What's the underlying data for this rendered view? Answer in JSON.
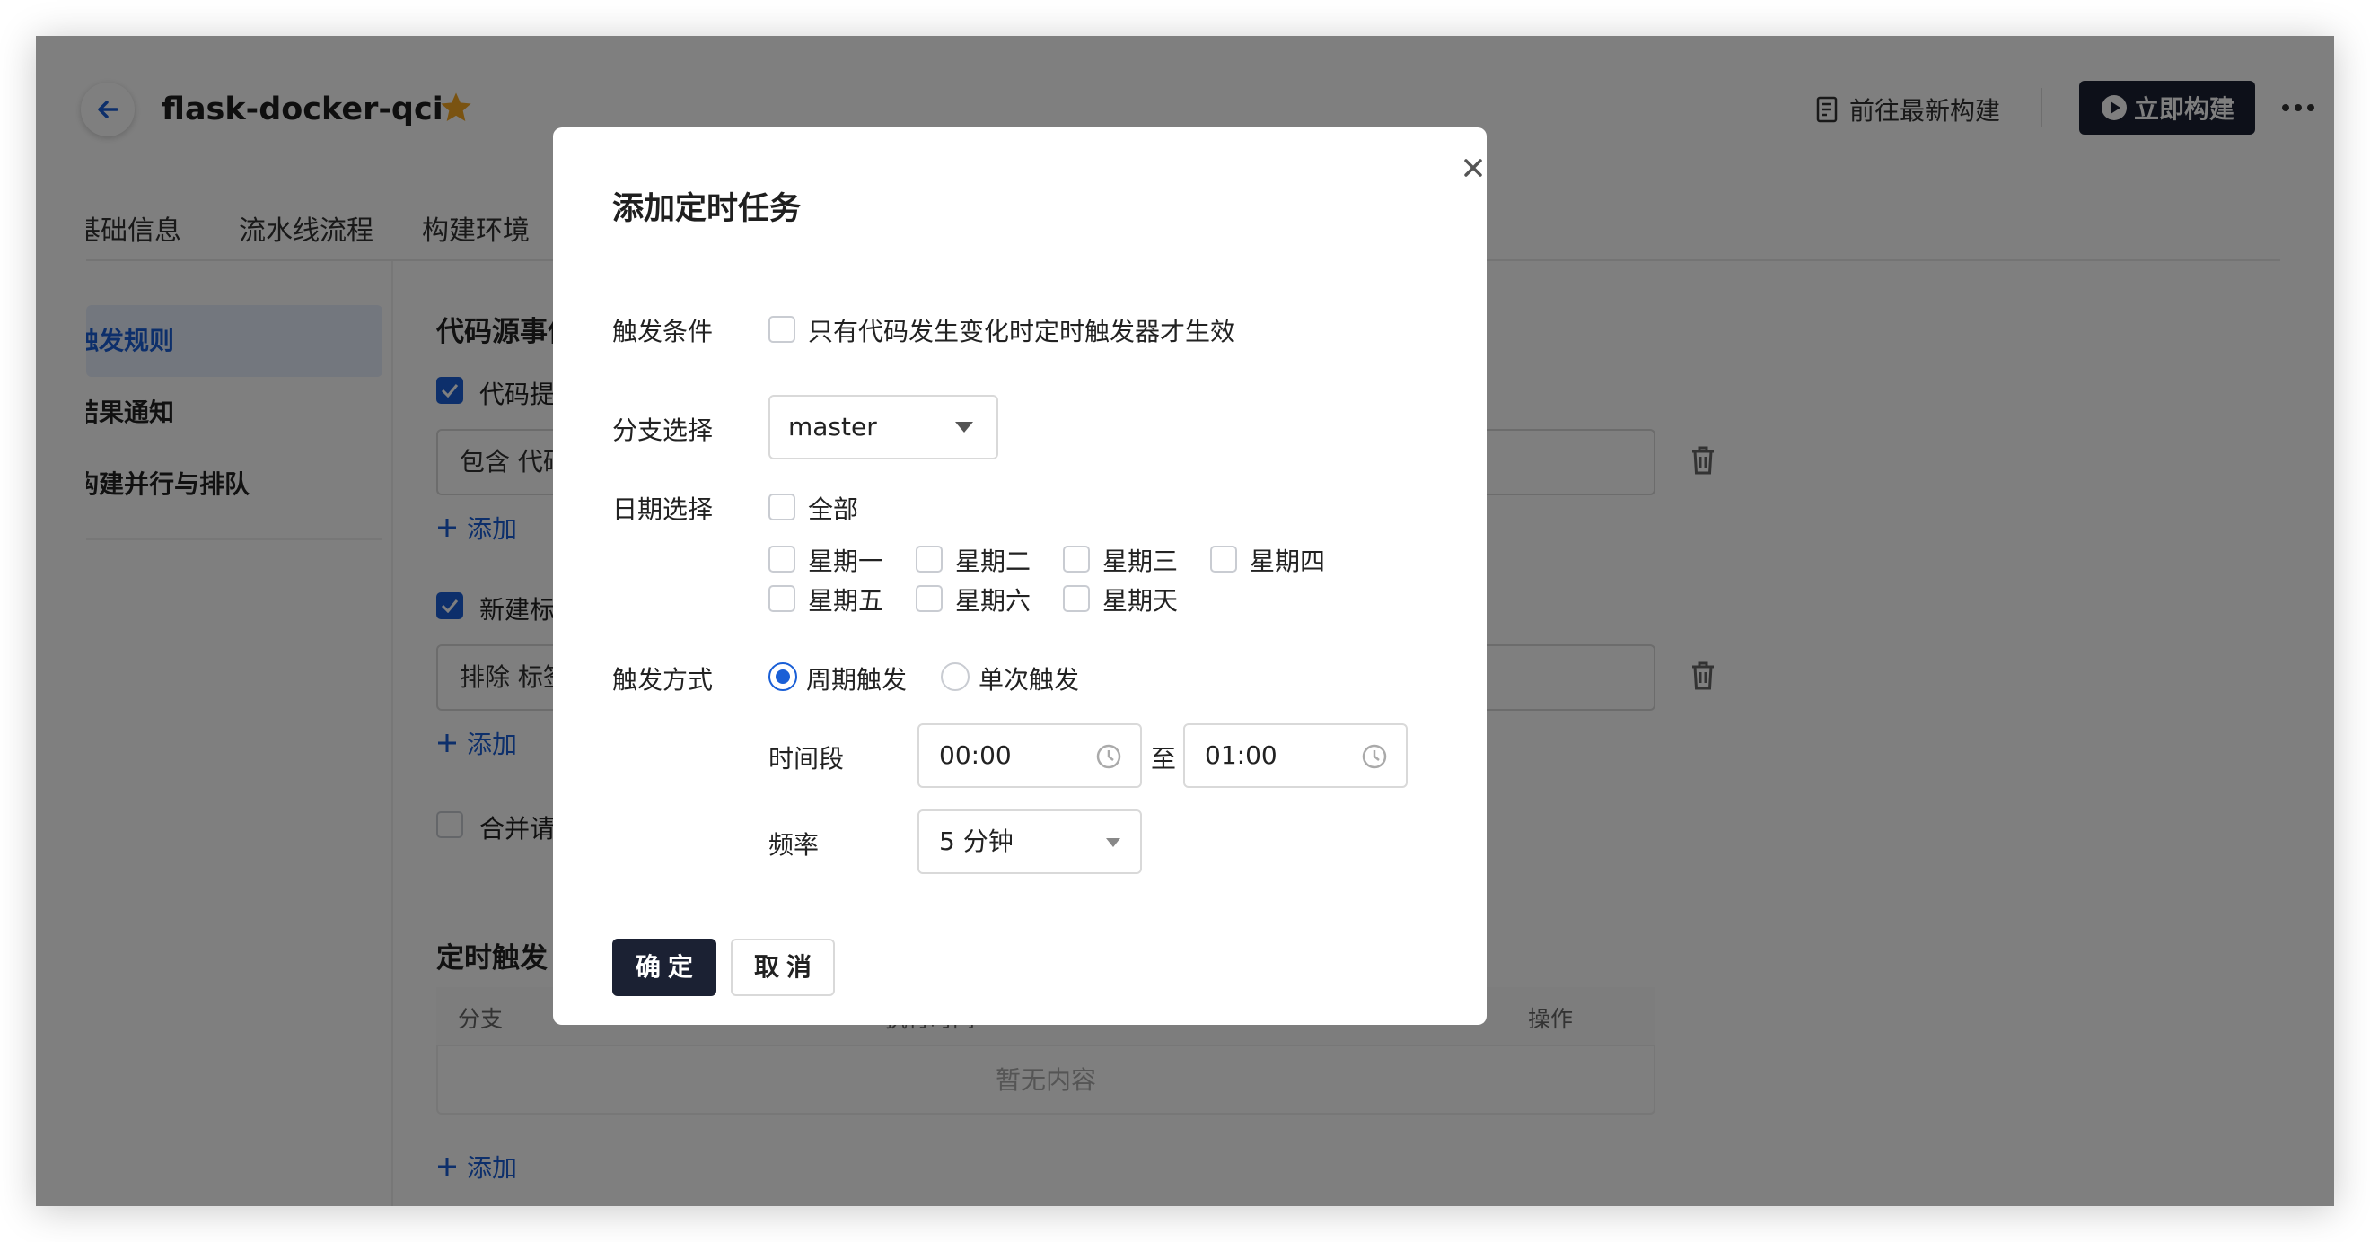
{
  "header": {
    "title": "flask-docker-qci",
    "latest_build_label": "前往最新构建",
    "build_now_label": "立即构建"
  },
  "tabs": [
    "基础信息",
    "流水线流程",
    "构建环境"
  ],
  "sidebar": {
    "items": [
      {
        "label": "触发规则",
        "active": true
      },
      {
        "label": "结果通知",
        "active": false
      },
      {
        "label": "构建并行与排队",
        "active": false
      }
    ]
  },
  "main": {
    "code_source_title": "代码源事件",
    "code_push": {
      "label": "代码提交",
      "checked": true,
      "input_value": "包含 代码",
      "add_label": "添加"
    },
    "new_tag": {
      "label": "新建标签",
      "checked": true,
      "input_value": "排除 标签",
      "add_label": "添加"
    },
    "merge_request": {
      "label": "合并请求",
      "checked": false
    },
    "timed_title": "定时触发",
    "timed_table": {
      "headers": [
        "分支",
        "执行时间",
        "操作"
      ],
      "empty_text": "暂无内容",
      "add_label": "添加"
    }
  },
  "modal": {
    "title": "添加定时任务",
    "trigger_condition_label": "触发条件",
    "trigger_condition_option": "只有代码发生变化时定时触发器才生效",
    "trigger_condition_checked": false,
    "branch_label": "分支选择",
    "branch_value": "master",
    "date_label": "日期选择",
    "all_label": "全部",
    "weekdays": [
      "星期一",
      "星期二",
      "星期三",
      "星期四",
      "星期五",
      "星期六",
      "星期天"
    ],
    "mode_label": "触发方式",
    "mode_options": [
      {
        "label": "周期触发",
        "selected": true
      },
      {
        "label": "单次触发",
        "selected": false
      }
    ],
    "time_range_label": "时间段",
    "time_start": "00:00",
    "time_separator": "至",
    "time_end": "01:00",
    "frequency_label": "频率",
    "frequency_value": "5 分钟",
    "ok_label": "确定",
    "cancel_label": "取消"
  },
  "colors": {
    "primary": "#1a5fd6",
    "dark_button": "#1b2133",
    "star": "#f5a623",
    "overlay": "rgba(0,0,0,0.5)"
  }
}
